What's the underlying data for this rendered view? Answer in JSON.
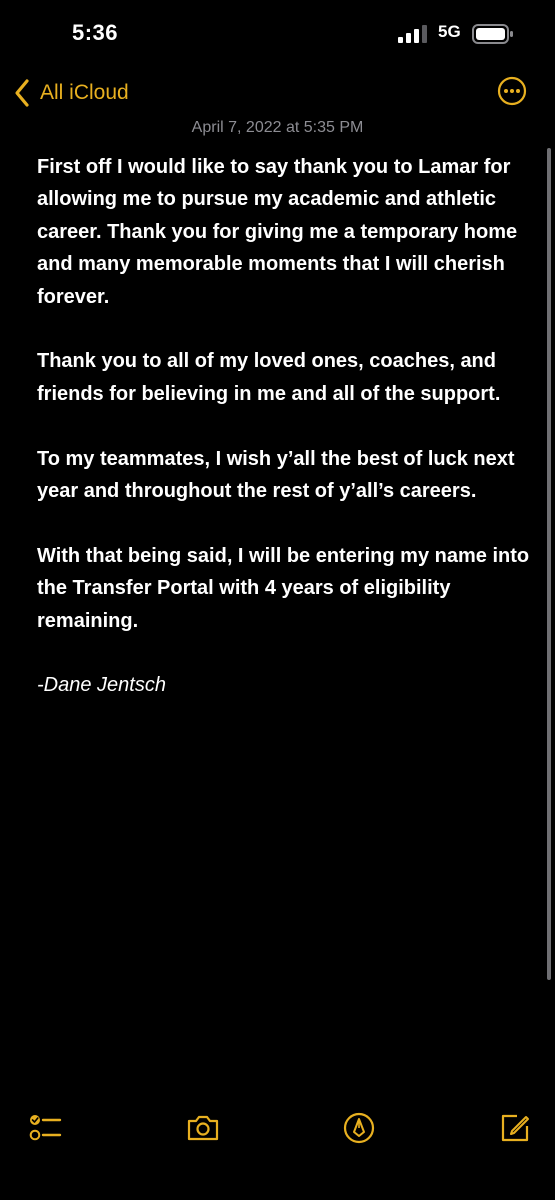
{
  "status_bar": {
    "time": "5:36",
    "network": "5G",
    "signal_bars_filled": 3,
    "signal_bars_total": 4
  },
  "nav": {
    "back_label": "All iCloud",
    "back_icon": "chevron-left-icon",
    "more_icon": "ellipsis-circle-icon"
  },
  "note": {
    "date": "April 7, 2022 at 5:35 PM",
    "paragraphs": [
      "First off I would like to say thank you to Lamar for allowing me to pursue my academic and athletic career. Thank you for giving me a temporary home and many memorable moments that I will cherish forever.",
      "Thank you to all of my loved ones, coaches, and friends for believing in me and all of the support.",
      "To my teammates, I wish y’all the best of luck next year and throughout the rest of y’all’s careers.",
      "With that being said, I will be entering my name into the Transfer Portal with 4 years of eligibility remaining."
    ],
    "signature": "-Dane Jentsch"
  },
  "toolbar": {
    "checklist_icon": "checklist-icon",
    "camera_icon": "camera-icon",
    "markup_icon": "markup-pen-icon",
    "compose_icon": "compose-icon"
  },
  "colors": {
    "accent": "#e8b020",
    "background": "#000000",
    "text": "#ffffff",
    "secondary_text": "#8d8d93"
  }
}
